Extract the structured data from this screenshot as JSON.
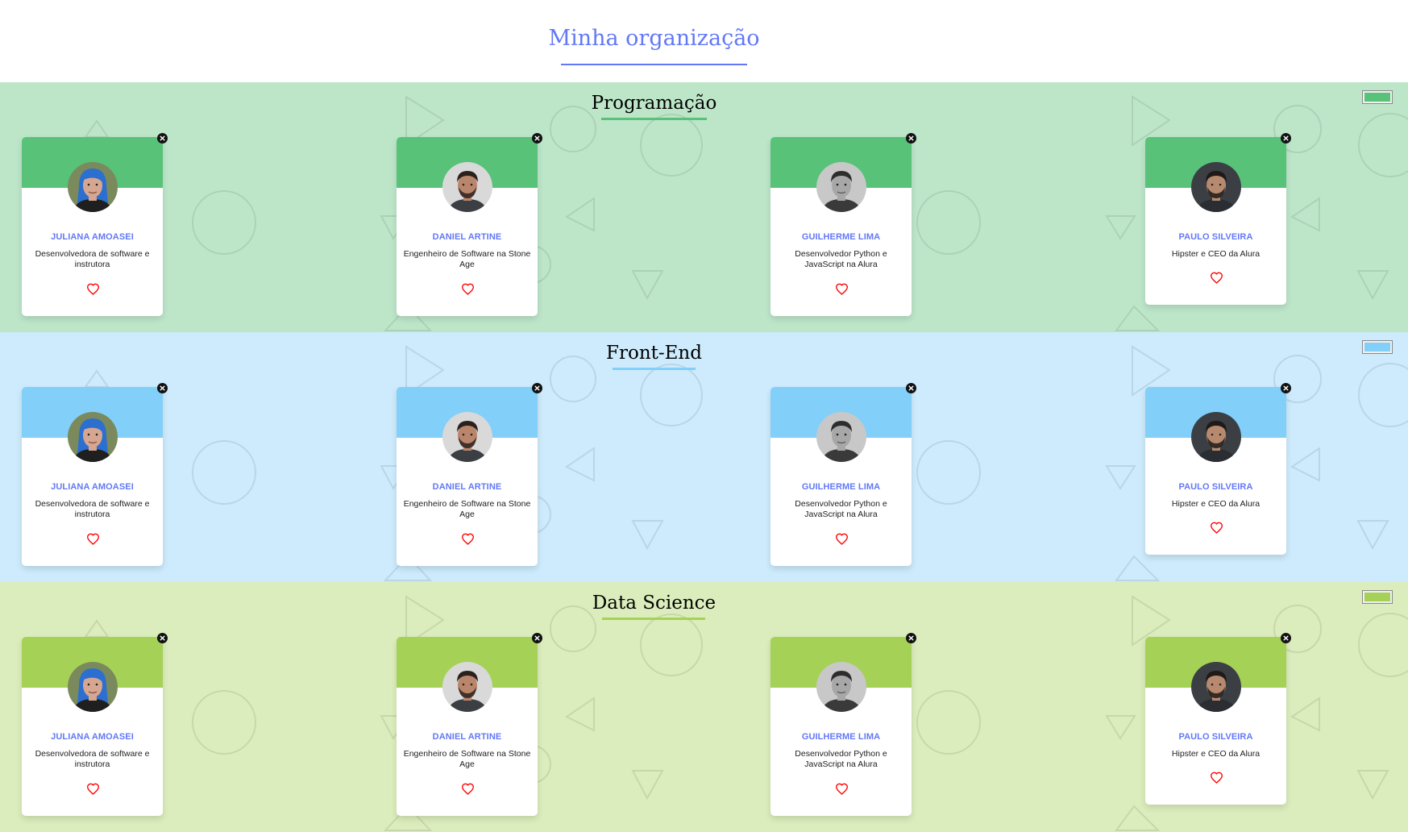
{
  "header": {
    "title": "Minha organização"
  },
  "icons": {
    "delete": "close-circle-icon",
    "favorite": "heart-outline-icon",
    "color_picker": "color-picker"
  },
  "colors": {
    "title_accent": "#6278f7",
    "favorite": "#ff0000"
  },
  "members": [
    {
      "name": "JULIANA AMOASEI",
      "role": "Desenvolvedora de software e instrutora"
    },
    {
      "name": "DANIEL ARTINE",
      "role": "Engenheiro de Software na Stone Age"
    },
    {
      "name": "GUILHERME LIMA",
      "role": "Desenvolvedor Python e JavaScript na Alura"
    },
    {
      "name": "PAULO SILVEIRA",
      "role": "Hipster e CEO da Alura"
    }
  ],
  "teams": [
    {
      "name": "Programação",
      "primary_color": "#57c278",
      "background_color": "#bde6c9"
    },
    {
      "name": "Front-End",
      "primary_color": "#82cffa",
      "background_color": "#cdebfc"
    },
    {
      "name": "Data Science",
      "primary_color": "#a6d157",
      "background_color": "#dbedbc"
    }
  ]
}
